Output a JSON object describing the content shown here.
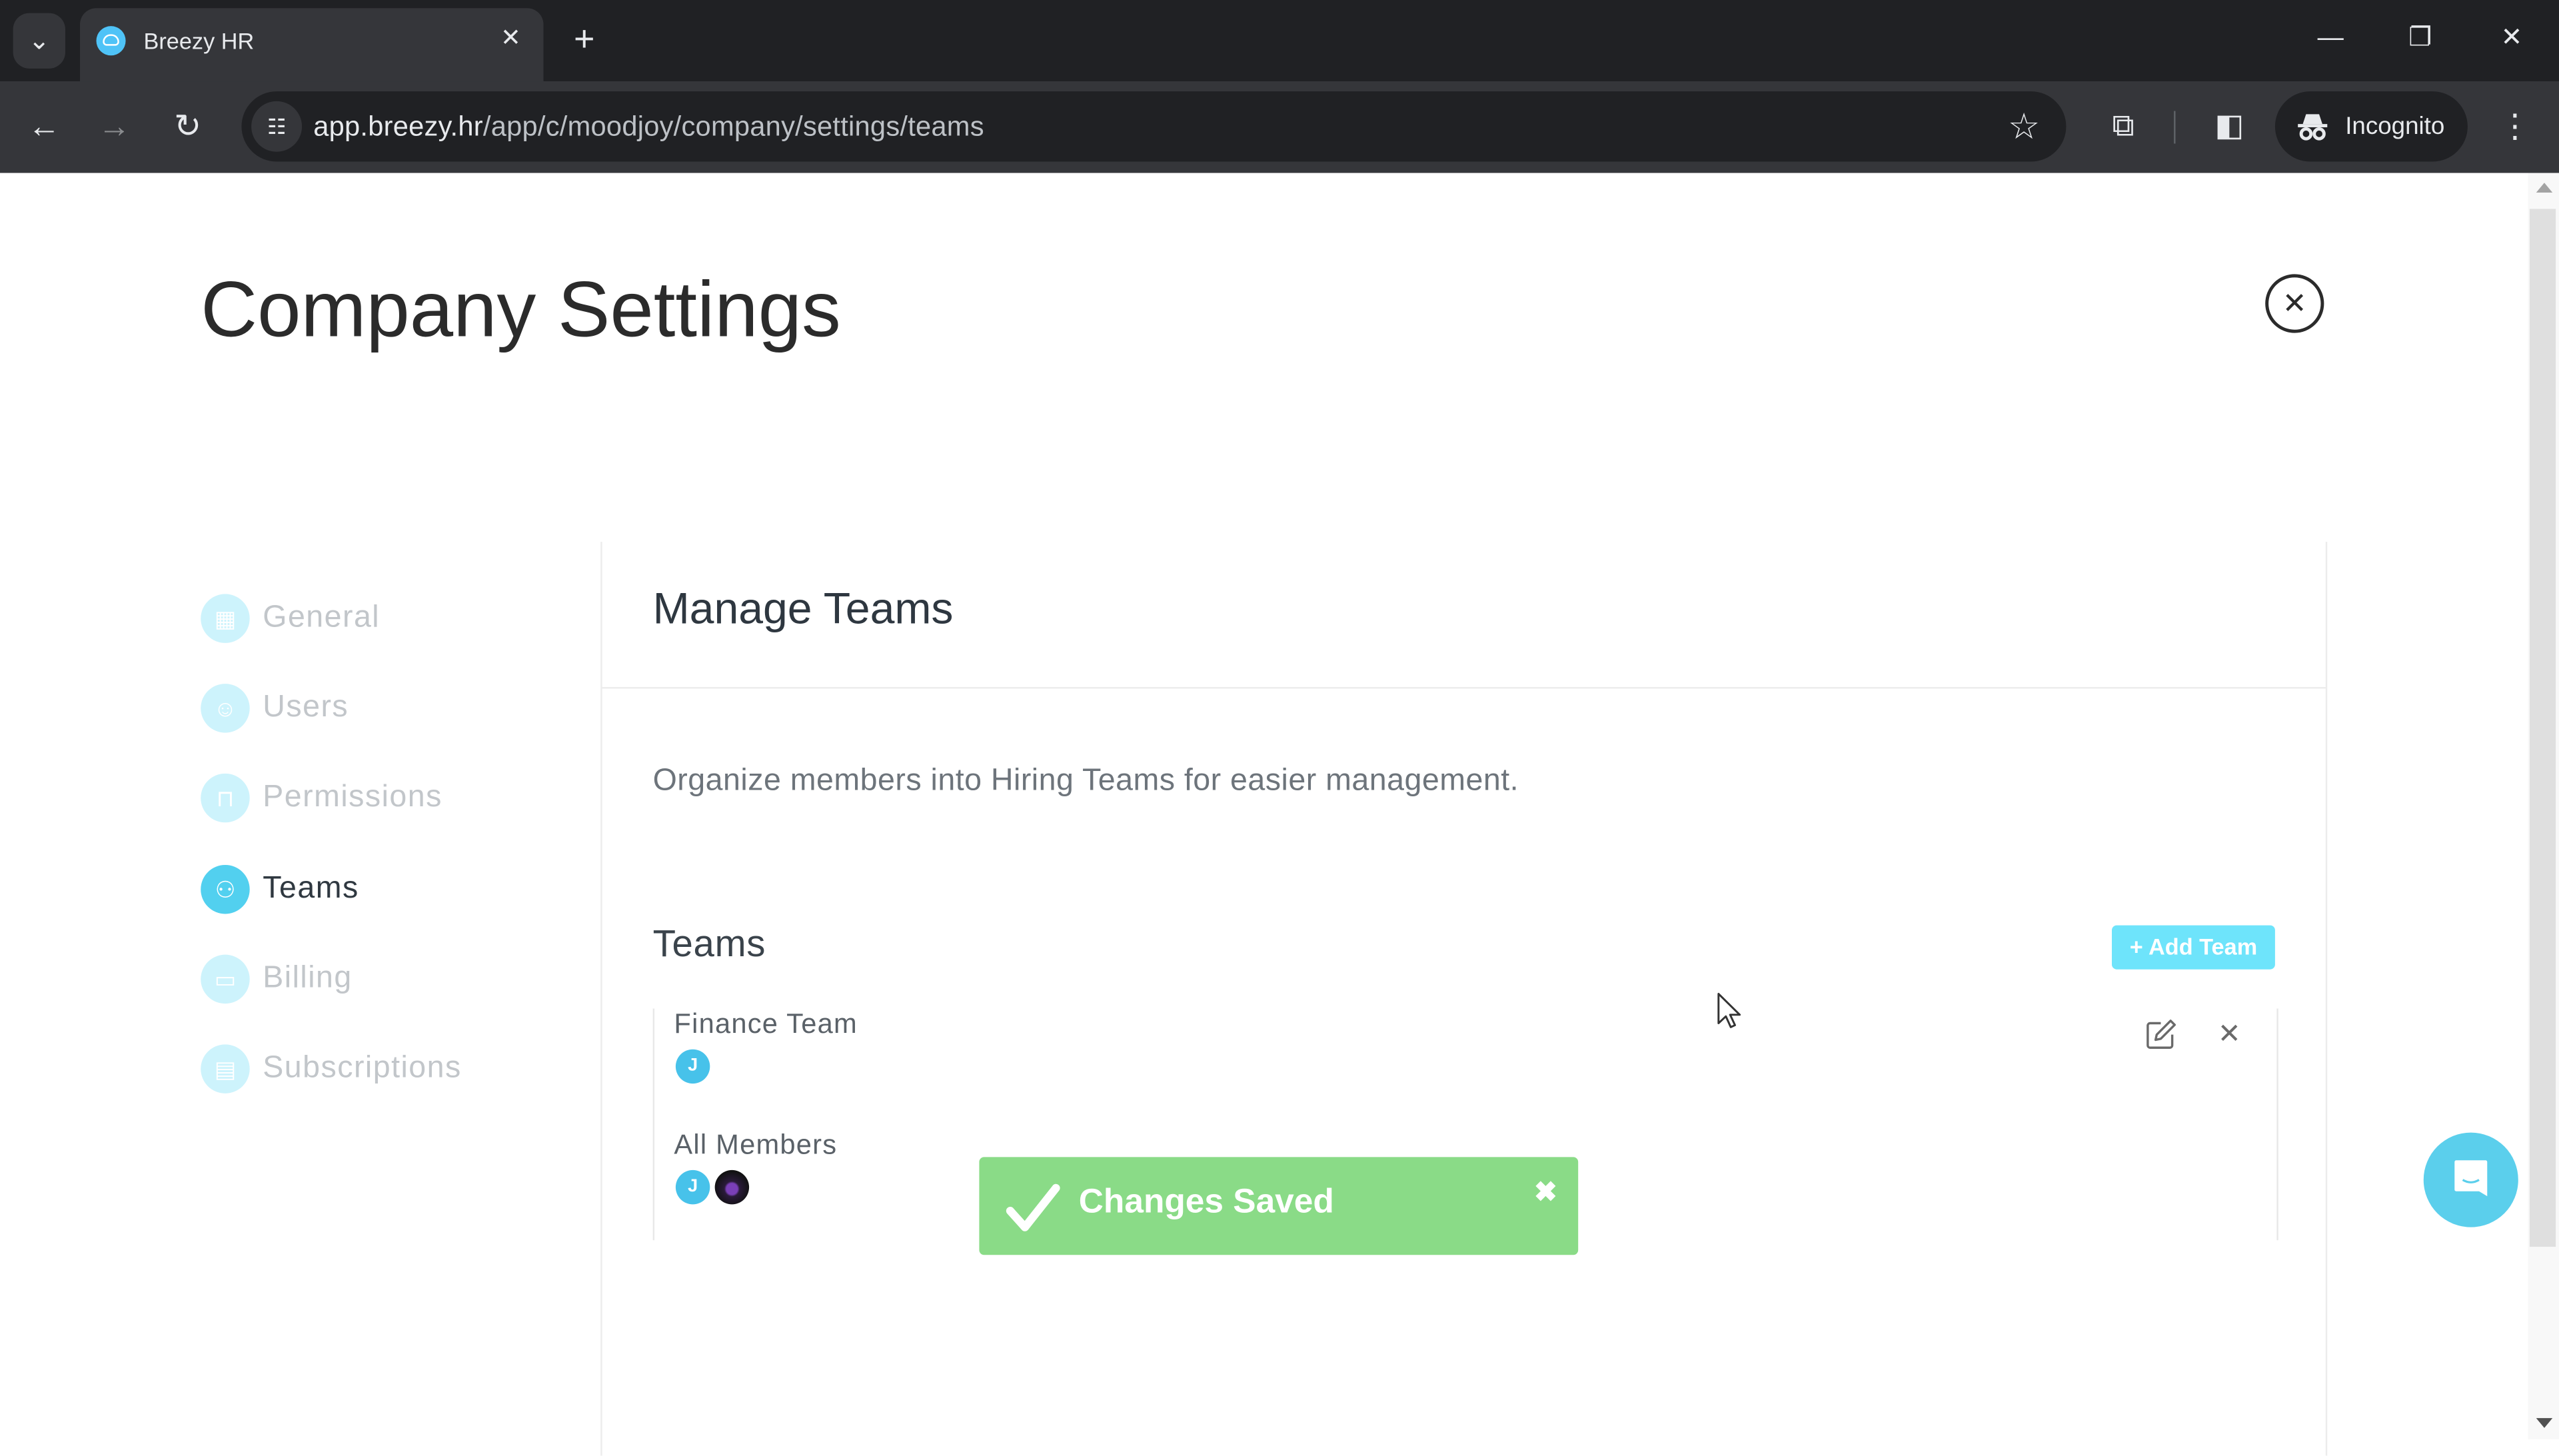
{
  "browser": {
    "tab_title": "Breezy HR",
    "url_host": "app.breezy.hr",
    "url_path": "/app/c/moodjoy/company/settings/teams",
    "incognito_label": "Incognito",
    "icons": {
      "tab_search": "chevron-down-icon",
      "tab_close": "close-icon",
      "new_tab": "plus-icon",
      "back": "arrow-left-icon",
      "forward": "arrow-right-icon",
      "reload": "reload-icon",
      "site_info": "tune-icon",
      "bookmark": "star-icon",
      "extensions": "puzzle-icon",
      "side_panel": "side-panel-icon",
      "incognito": "incognito-icon",
      "menu": "more-vertical-icon",
      "minimize": "minimize-icon",
      "restore": "restore-icon",
      "close_window": "close-icon"
    },
    "glyphs": {
      "tab_search": "⌄",
      "tab_close": "✕",
      "new_tab": "+",
      "back": "←",
      "forward": "→",
      "reload": "↻",
      "site_info": "☷",
      "bookmark": "☆",
      "extensions": "⧉",
      "side_panel": "◧",
      "incognito": "🕵",
      "menu": "⋮",
      "minimize": "—",
      "restore": "❐",
      "close_window": "✕"
    }
  },
  "page": {
    "title": "Company Settings",
    "close_glyph": "✕"
  },
  "sidebar": {
    "items": [
      {
        "label": "General",
        "icon": "building-icon",
        "glyph": "▦",
        "active": false
      },
      {
        "label": "Users",
        "icon": "user-icon",
        "glyph": "☺",
        "active": false
      },
      {
        "label": "Permissions",
        "icon": "lock-icon",
        "glyph": "⊓",
        "active": false
      },
      {
        "label": "Teams",
        "icon": "users-group-icon",
        "glyph": "⚇",
        "active": true
      },
      {
        "label": "Billing",
        "icon": "credit-card-icon",
        "glyph": "▭",
        "active": false
      },
      {
        "label": "Subscriptions",
        "icon": "receipt-icon",
        "glyph": "▤",
        "active": false
      }
    ]
  },
  "panel": {
    "title": "Manage Teams",
    "description": "Organize members into Hiring Teams for easier management.",
    "teams_heading": "Teams",
    "add_team_label": "+ Add Team",
    "teams": [
      {
        "name": "Finance Team",
        "members": [
          {
            "type": "initial",
            "text": "J"
          }
        ],
        "actions": true
      },
      {
        "name": "All Members",
        "members": [
          {
            "type": "initial",
            "text": "J"
          },
          {
            "type": "photo",
            "text": ""
          }
        ],
        "actions": false
      }
    ]
  },
  "toast": {
    "message": "Changes Saved",
    "close_glyph": "✖",
    "color": "#8adb87"
  },
  "colors": {
    "accent": "#52d0ef",
    "add_button": "#6ee4fb",
    "chat": "#5bcfec"
  }
}
